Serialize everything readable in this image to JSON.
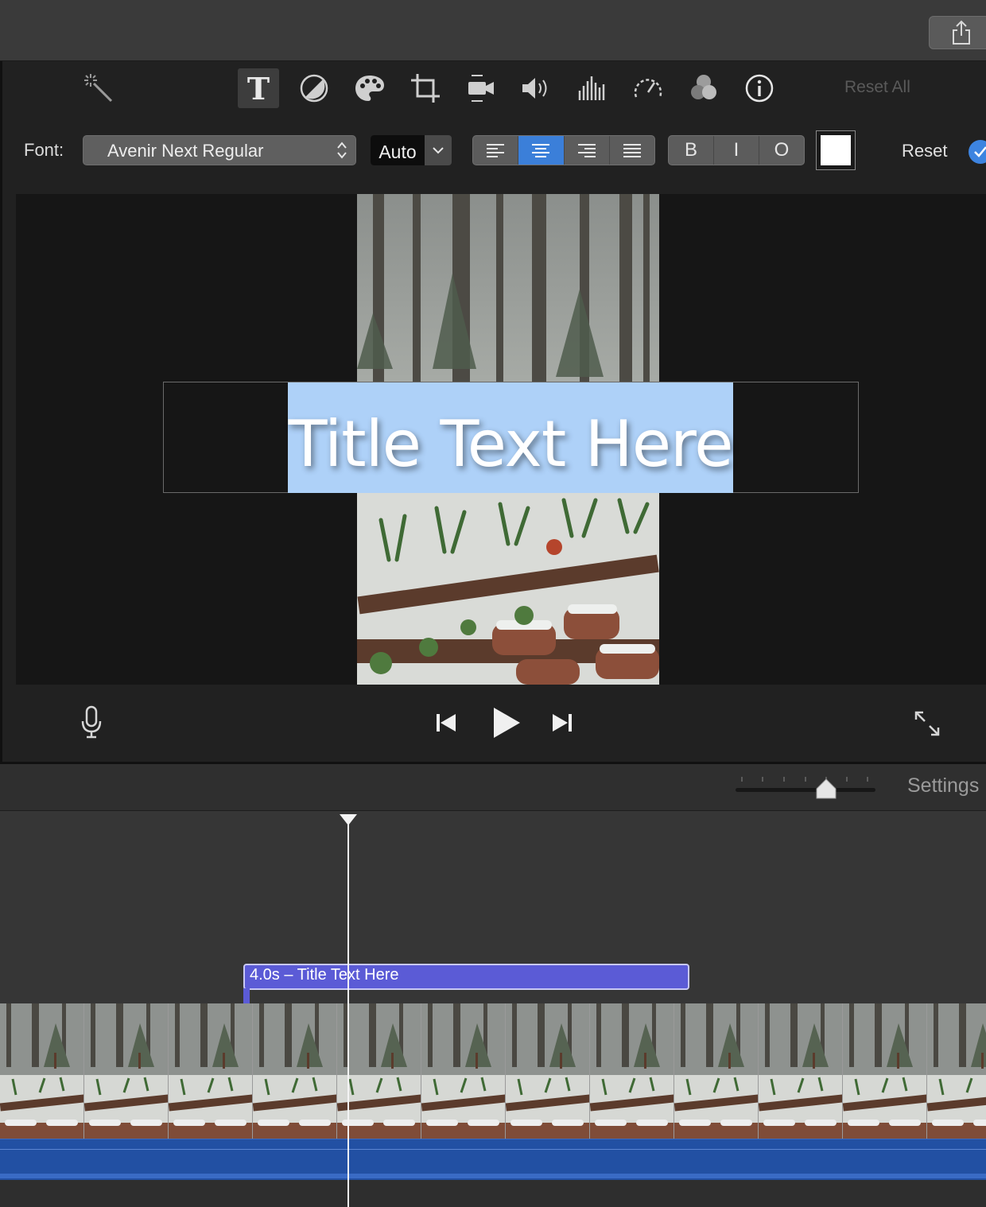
{
  "toolbar": {
    "share_icon": "share-icon",
    "reset_all_label": "Reset All",
    "tools": [
      {
        "name": "magic-wand-icon",
        "active": false
      },
      {
        "name": "title-text-icon",
        "active": true
      },
      {
        "name": "color-balance-icon",
        "active": false
      },
      {
        "name": "color-correction-palette-icon",
        "active": false
      },
      {
        "name": "crop-icon",
        "active": false
      },
      {
        "name": "stabilization-camera-icon",
        "active": false
      },
      {
        "name": "volume-icon",
        "active": false
      },
      {
        "name": "equalizer-icon",
        "active": false
      },
      {
        "name": "speed-gauge-icon",
        "active": false
      },
      {
        "name": "clip-filter-icon",
        "active": false
      },
      {
        "name": "info-icon",
        "active": false
      }
    ]
  },
  "text_inspector": {
    "font_label": "Font:",
    "font_value": "Avenir Next Regular",
    "size_value": "Auto",
    "alignment_options": [
      "left",
      "center",
      "right",
      "justify"
    ],
    "alignment_selected": "center",
    "style_buttons": [
      "B",
      "I",
      "O"
    ],
    "text_color": "#ffffff",
    "reset_label": "Reset",
    "accent_color": "#3b7fd9"
  },
  "viewer": {
    "title_text": "Title Text Here",
    "selection_color": "#aed1f8"
  },
  "transport": {
    "voiceover_icon": "microphone-icon",
    "prev_icon": "skip-back-icon",
    "play_icon": "play-icon",
    "next_icon": "skip-forward-icon",
    "fullscreen_icon": "fullscreen-icon"
  },
  "timeline": {
    "settings_label": "Settings",
    "zoom_level": 0.65,
    "title_clip_label": "4.0s – Title Text Here",
    "title_clip_color": "#5b5bd6",
    "audio_color": "#2250a3"
  }
}
